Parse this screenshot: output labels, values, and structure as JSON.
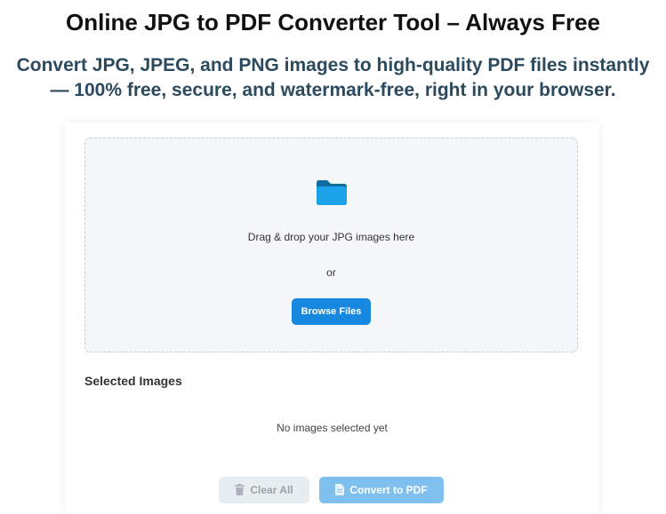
{
  "header": {
    "title": "Online JPG to PDF Converter Tool – Always Free",
    "subtitle": "Convert JPG, JPEG, and PNG images to high-quality PDF files instantly — 100% free, secure, and watermark-free, right in your browser."
  },
  "dropzone": {
    "icon": "folder-icon",
    "instruction": "Drag & drop your JPG images here",
    "or_text": "or",
    "browse_label": "Browse Files"
  },
  "selected": {
    "title": "Selected Images",
    "empty_text": "No images selected yet"
  },
  "actions": {
    "clear_label": "Clear All",
    "clear_icon": "trash-icon",
    "convert_label": "Convert to PDF",
    "convert_icon": "document-icon"
  },
  "colors": {
    "accent": "#1688e0",
    "subtitle": "#2c4a5e",
    "folder_dark": "#0f6e9e",
    "folder_light": "#1aa3e8"
  }
}
